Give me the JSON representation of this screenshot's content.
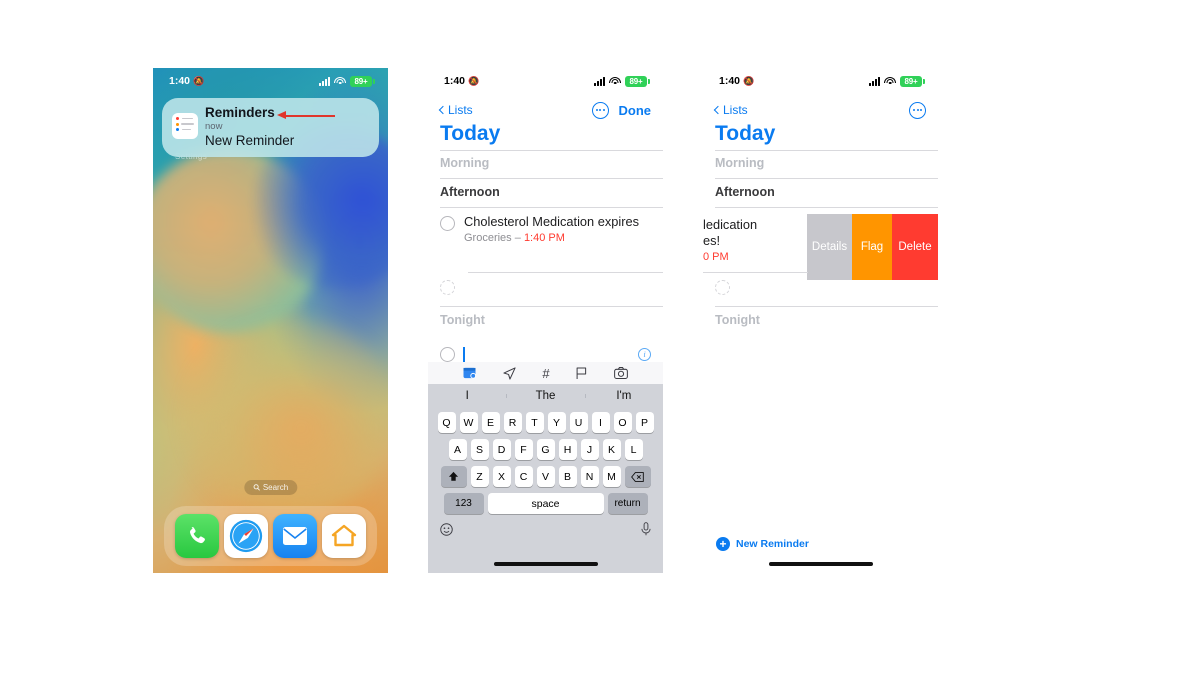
{
  "phones": [
    {
      "id": "home-screen",
      "status": {
        "time": "1:40",
        "silent_icon": "bell-slash-icon",
        "battery": "89+"
      },
      "notification": {
        "app": "Reminders",
        "time": "now",
        "message": "New Reminder",
        "ghost_label": "Settings",
        "icon": "reminders-app-icon"
      },
      "search_pill": "Search",
      "dock": [
        {
          "name": "Phone",
          "icon": "phone-icon"
        },
        {
          "name": "Safari",
          "icon": "compass-icon"
        },
        {
          "name": "Mail",
          "icon": "envelope-icon"
        },
        {
          "name": "Home",
          "icon": "house-icon"
        }
      ]
    },
    {
      "id": "reminders-edit",
      "status": {
        "time": "1:40",
        "silent_icon": "bell-slash-icon",
        "battery": "89+"
      },
      "nav": {
        "back": "Lists",
        "more": "ellipsis-icon",
        "done": "Done"
      },
      "title": "Today",
      "sections": [
        {
          "label": "Morning",
          "muted": true
        },
        {
          "label": "Afternoon",
          "muted": false
        },
        {
          "label": "Tonight",
          "muted": true
        }
      ],
      "reminder": {
        "title": "Cholesterol Medication expires",
        "list": "Groceries",
        "separator": "–",
        "time": "1:40 PM"
      },
      "keyboard": {
        "toolbar_icons": [
          "calendar-icon",
          "location-arrow-icon",
          "hashtag-icon",
          "flag-icon",
          "camera-icon"
        ],
        "suggestions": [
          "I",
          "The",
          "I'm"
        ],
        "row1": [
          "Q",
          "W",
          "E",
          "R",
          "T",
          "Y",
          "U",
          "I",
          "O",
          "P"
        ],
        "row2": [
          "A",
          "S",
          "D",
          "F",
          "G",
          "H",
          "J",
          "K",
          "L"
        ],
        "row3": [
          "Z",
          "X",
          "C",
          "V",
          "B",
          "N",
          "M"
        ],
        "shift": "shift-icon",
        "backspace": "backspace-icon",
        "numbers": "123",
        "space": "space",
        "return": "return",
        "emoji": "emoji-icon",
        "mic": "microphone-icon"
      }
    },
    {
      "id": "reminders-swipe",
      "status": {
        "time": "1:40",
        "silent_icon": "bell-slash-icon",
        "battery": "89+"
      },
      "nav": {
        "back": "Lists",
        "more": "ellipsis-icon"
      },
      "title": "Today",
      "sections": [
        {
          "label": "Morning",
          "muted": true
        },
        {
          "label": "Afternoon",
          "muted": false
        },
        {
          "label": "Tonight",
          "muted": true
        }
      ],
      "reminder_clipped": {
        "line1": "ledication",
        "line2": "es!",
        "line3": "0 PM"
      },
      "swipe_actions": [
        {
          "label": "Details",
          "color": "#c7c7cc"
        },
        {
          "label": "Flag",
          "color": "#ff9500"
        },
        {
          "label": "Delete",
          "color": "#ff3b30"
        }
      ],
      "new_reminder": "New Reminder"
    }
  ],
  "colors": {
    "accent_blue": "#0a7bf0",
    "red": "#ff3b30",
    "orange": "#ff9500",
    "gray": "#c7c7cc",
    "green_battery": "#30d158"
  }
}
